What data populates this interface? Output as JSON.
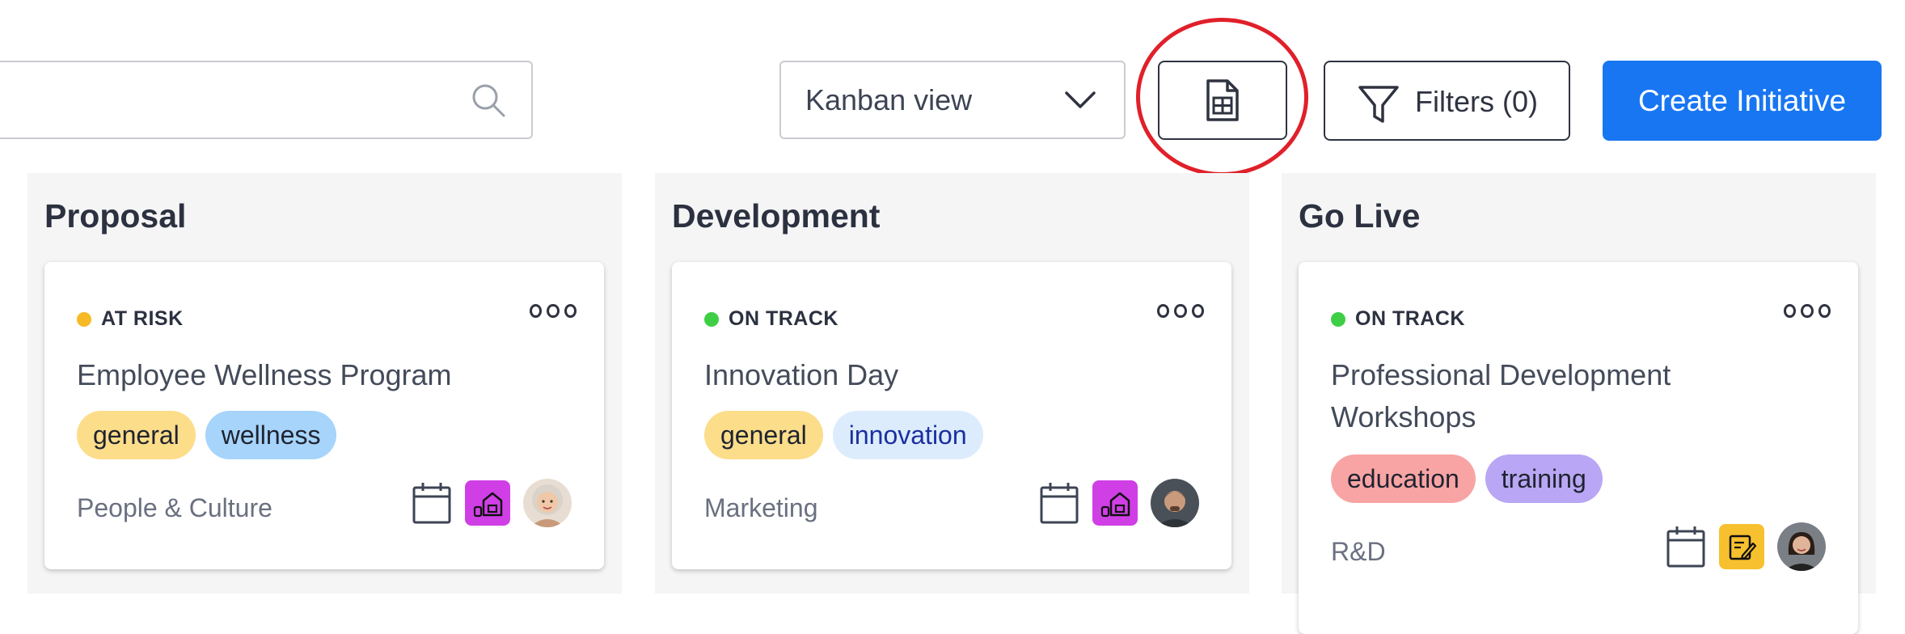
{
  "toolbar": {
    "search": {
      "value": "",
      "placeholder": ""
    },
    "view_select": {
      "selected": "Kanban view"
    },
    "filters_label": "Filters (0)",
    "create_label": "Create Initiative"
  },
  "columns": [
    {
      "title": "Proposal",
      "card": {
        "status": "AT RISK",
        "status_color": "#f7b924",
        "title": "Employee Wellness Program",
        "tags": [
          "general",
          "wellness"
        ],
        "team": "People & Culture",
        "type_icon": "home-office-icon",
        "avatar": "woman-gray-hair-avatar"
      }
    },
    {
      "title": "Development",
      "card": {
        "status": "ON TRACK",
        "status_color": "#3ecf47",
        "title": "Innovation Day",
        "tags": [
          "general",
          "innovation"
        ],
        "team": "Marketing",
        "type_icon": "home-office-icon",
        "avatar": "man-dark-hair-avatar"
      }
    },
    {
      "title": "Go Live",
      "card": {
        "status": "ON TRACK",
        "status_color": "#3ecf47",
        "title": "Professional Development Workshops",
        "tags": [
          "education",
          "training"
        ],
        "team": "R&D",
        "type_icon": "edit-note-icon",
        "avatar": "woman-dark-hair-avatar"
      }
    }
  ],
  "colors": {
    "primary": "#1876f2",
    "highlight_ring": "#e0202a",
    "at_risk": "#f7b924",
    "on_track": "#3ecf47"
  }
}
